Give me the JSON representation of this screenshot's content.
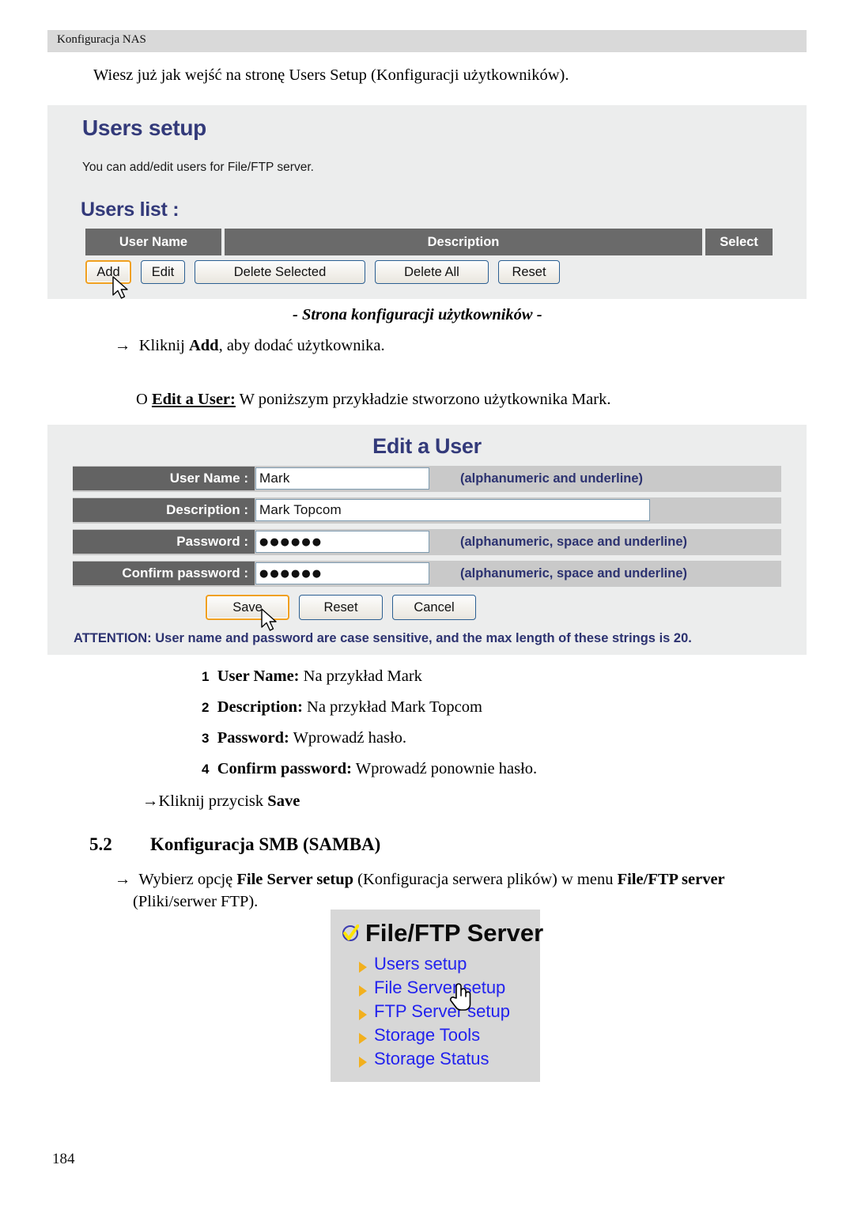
{
  "header": {
    "running_head": "Konfiguracja NAS"
  },
  "intro": {
    "line": "Wiesz już jak wejść na stronę Users Setup (Konfiguracji użytkowników)."
  },
  "users_setup_panel": {
    "title": "Users setup",
    "description": "You can add/edit users for File/FTP server.",
    "list_title": "Users list  :",
    "columns": [
      "User Name",
      "Description",
      "Select"
    ],
    "rows": [],
    "buttons": [
      {
        "label": "Add",
        "focused": true
      },
      {
        "label": "Edit",
        "focused": false
      },
      {
        "label": "Delete Selected",
        "focused": false
      },
      {
        "label": "Delete All",
        "focused": false
      },
      {
        "label": "Reset",
        "focused": false
      }
    ]
  },
  "caption_users": "- Strona konfiguracji użytkowników -",
  "step_add": {
    "arrow": "→",
    "pre": "Kliknij ",
    "bold": "Add",
    "post": ", aby dodać użytkownika."
  },
  "bullet_edit_user": {
    "marker": "O",
    "bold": "Edit a User:",
    "text": " W poniższym przykładzie stworzono użytkownika Mark."
  },
  "edit_user_panel": {
    "title": "Edit a User",
    "fields": [
      {
        "label": "User Name  :",
        "value": "Mark",
        "type": "text",
        "hint": "(alphanumeric and underline)"
      },
      {
        "label": "Description  :",
        "value": "Mark Topcom",
        "type": "text",
        "hint": ""
      },
      {
        "label": "Password  :",
        "value": "●●●●●●",
        "type": "password",
        "hint": "(alphanumeric, space and underline)"
      },
      {
        "label": "Confirm password  :",
        "value": "●●●●●●",
        "type": "password",
        "hint": "(alphanumeric, space and underline)"
      }
    ],
    "buttons": [
      {
        "label": "Save",
        "focused": true
      },
      {
        "label": "Reset",
        "focused": false
      },
      {
        "label": "Cancel",
        "focused": false
      }
    ],
    "attention": "ATTENTION: User name and password are case sensitive, and the max length of these strings is 20."
  },
  "numbered_steps": [
    {
      "n": "1",
      "bold": "User Name:",
      "text": " Na przykład Mark"
    },
    {
      "n": "2",
      "bold": "Description:",
      "text": " Na przykład Mark Topcom"
    },
    {
      "n": "3",
      "bold": "Password:",
      "text": " Wprowadź hasło."
    },
    {
      "n": "4",
      "bold": "Confirm password:",
      "text": " Wprowadź ponownie hasło."
    }
  ],
  "step_save": {
    "arrow": "→",
    "pre": "Kliknij przycisk ",
    "bold": "Save"
  },
  "section": {
    "number": "5.2",
    "title": "Konfiguracja SMB (SAMBA)",
    "body_arrow": "→",
    "body_1": "Wybierz opcję ",
    "body_b1": "File Server setup",
    "body_2": " (Konfiguracja serwera plików) w menu ",
    "body_b2": "File/FTP server",
    "body_3": "(Pliki/serwer FTP)."
  },
  "ftp_menu": {
    "title": "File/FTP Server",
    "items": [
      {
        "label": "Users setup"
      },
      {
        "label": "File Server setup"
      },
      {
        "label": "FTP Server setup"
      },
      {
        "label": "Storage Tools"
      },
      {
        "label": "Storage Status"
      }
    ]
  },
  "footer": {
    "page_number": "184"
  },
  "colors": {
    "running_head_bg": "#d9d9d9",
    "panel_bg": "#eceded",
    "table_header_bg": "#6a6a6a",
    "field_label_bg": "#636363",
    "row_bg": "#c9c9c9",
    "heading_blue": "#333a7a",
    "hint_blue": "#2c3270",
    "link_blue": "#2222ee",
    "focus_orange": "#f0a020",
    "arrow_gold": "#f2b01e",
    "ftp_box_bg": "#d7d7d7"
  }
}
